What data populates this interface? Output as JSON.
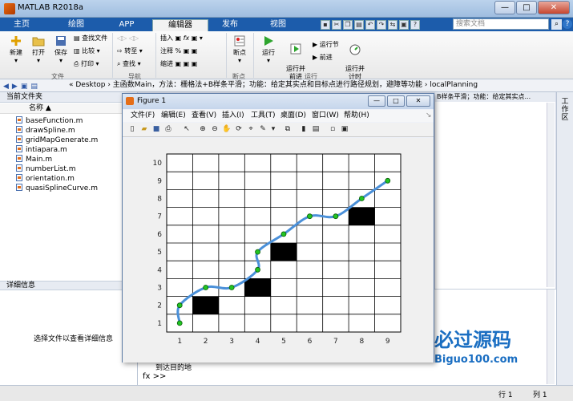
{
  "window": {
    "title": "MATLAB R2018a",
    "min": "—",
    "max": "□",
    "close": "✕"
  },
  "tabs": [
    "主页",
    "绘图",
    "APP",
    "编辑器",
    "发布",
    "视图"
  ],
  "search": {
    "placeholder": "搜索文档"
  },
  "help": "?",
  "ribbon": {
    "new": "新建",
    "open": "打开",
    "save": "保存",
    "findfiles": "查找文件",
    "compare": "比较",
    "print": "打印",
    "goto": "转至",
    "find": "查找",
    "insert": "插入",
    "comment": "注释",
    "indent": "缩进",
    "breakpoints": "断点",
    "run": "运行",
    "runadvance": "运行并\n前进",
    "runsection": "运行节",
    "advance": "前进",
    "runtime": "运行并\n计时",
    "sections": [
      "文件",
      "导航",
      "断点",
      "运行"
    ]
  },
  "address": {
    "path": "«  Desktop  ›  主函数Main，方法：栅格法+B样条平滑；功能：给定其实点和目标点进行路径规划，避障等功能  ›  localPlanning"
  },
  "leftpane": {
    "title": "当前文件夹",
    "colname": "名称 ▲",
    "files": [
      "baseFunction.m",
      "drawSpline.m",
      "gridMapGenerate.m",
      "intiapara.m",
      "Main.m",
      "numberList.m",
      "orientation.m",
      "quasiSplineCurve.m"
    ],
    "detail_title": "详细信息",
    "detail_text": "选择文件以查看详细信息"
  },
  "rightpane": {
    "header": "B样条平滑；功能：给定其实点..."
  },
  "workspace_label": "工作区",
  "command": {
    "text": "到达目的地",
    "prompt": "fx >>"
  },
  "status": {
    "row": "行  1",
    "col": "列  1"
  },
  "watermark": {
    "main": "必过源码",
    "sub": "Biguo100.com"
  },
  "figure": {
    "title": "Figure 1",
    "menu": [
      "文件(F)",
      "编辑(E)",
      "查看(V)",
      "插入(I)",
      "工具(T)",
      "桌面(D)",
      "窗口(W)",
      "帮助(H)"
    ],
    "min": "—",
    "max": "□",
    "close": "✕"
  },
  "chart_data": {
    "type": "line",
    "title": "",
    "xlabel": "",
    "ylabel": "",
    "xlim": [
      0.5,
      9.5
    ],
    "ylim": [
      0.5,
      10.5
    ],
    "xticks": [
      1,
      2,
      3,
      4,
      5,
      6,
      7,
      8,
      9
    ],
    "yticks": [
      1,
      2,
      3,
      4,
      5,
      6,
      7,
      8,
      9,
      10
    ],
    "grid": true,
    "obstacles": [
      [
        2,
        2
      ],
      [
        4,
        3
      ],
      [
        5,
        5
      ],
      [
        8,
        7
      ]
    ],
    "waypoints": {
      "x": [
        1,
        1,
        2,
        3,
        4,
        4,
        5,
        6,
        7,
        8,
        9
      ],
      "y": [
        1,
        2,
        3,
        3,
        4,
        5,
        6,
        7,
        7,
        8,
        9
      ]
    },
    "line_color": "#4a90d9",
    "marker_color": "#22c422"
  }
}
